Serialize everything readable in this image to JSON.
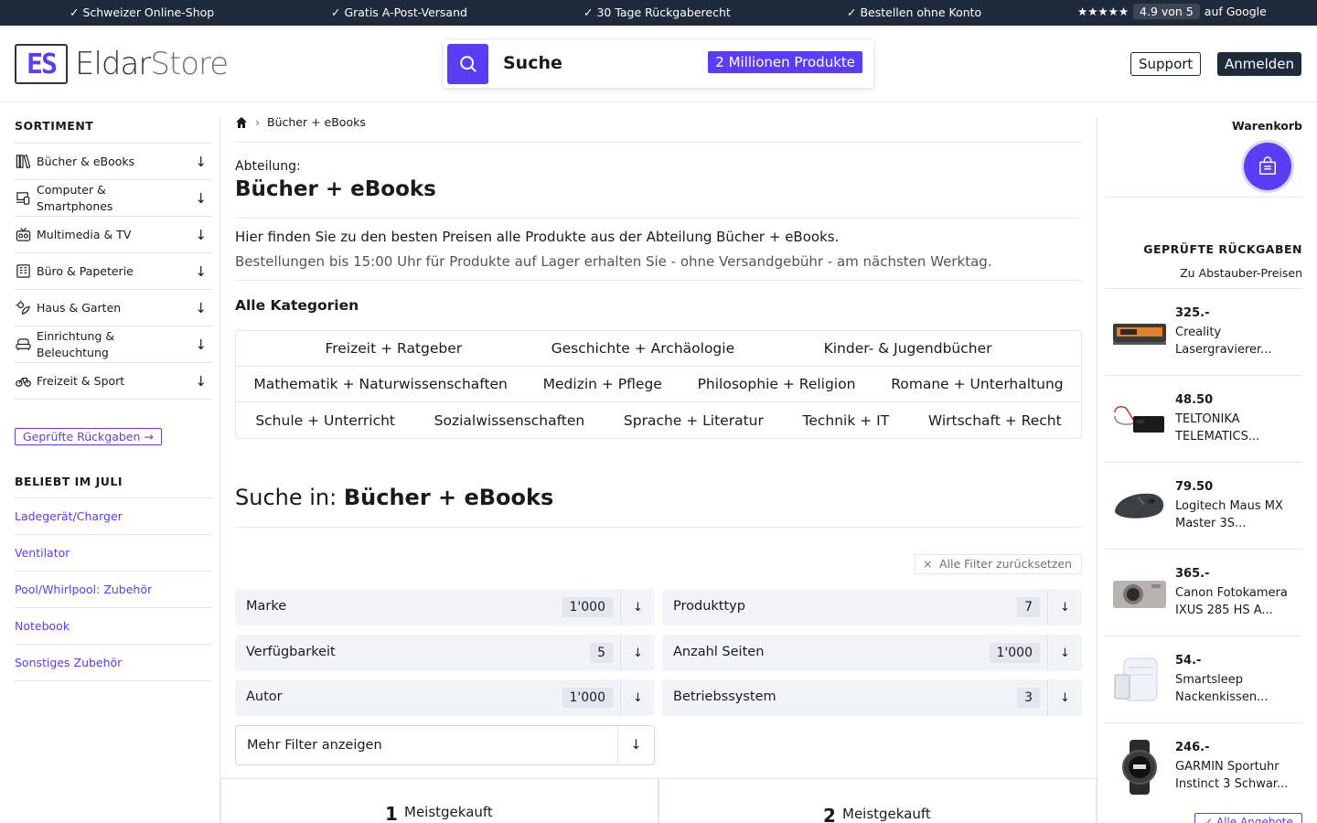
{
  "topbar": {
    "items": [
      "✓ Schweizer Online-Shop",
      "✓ Gratis A-Post-Versand",
      "✓ 30 Tage Rückgaberecht",
      "✓ Bestellen ohne Konto"
    ],
    "rating_stars": "★★★★★",
    "rating_score": "4.9 von 5",
    "rating_suffix": "auf Google"
  },
  "header": {
    "logo_mark": "ES",
    "logo_name": "Eldar",
    "logo_store": "Store",
    "search_label": "Suche",
    "search_badge": "2 Millionen Produkte",
    "support": "Support",
    "login": "Anmelden"
  },
  "sidebar": {
    "heading": "SORTIMENT",
    "categories": [
      {
        "label": "Bücher & eBooks",
        "icon": "books-icon"
      },
      {
        "label": "Computer & Smartphones",
        "icon": "devices-icon"
      },
      {
        "label": "Multimedia & TV",
        "icon": "tv-icon"
      },
      {
        "label": "Büro & Papeterie",
        "icon": "office-icon"
      },
      {
        "label": "Haus & Garten",
        "icon": "garden-icon"
      },
      {
        "label": "Einrichtung & Beleuchtung",
        "icon": "armchair-icon"
      },
      {
        "label": "Freizeit & Sport",
        "icon": "bicycle-icon"
      }
    ],
    "arrow": "↓",
    "returns_button": "Geprüfte Rückgaben →",
    "popular_heading": "BELIEBT IM JULI",
    "popular": [
      "Ladegerät/Charger",
      "Ventilator",
      "Pool/Whirlpool: Zubehör",
      "Notebook",
      "Sonstiges Zubehör"
    ]
  },
  "main": {
    "breadcrumb": "Bücher + eBooks",
    "dept_label": "Abteilung:",
    "dept_title": "Bücher + eBooks",
    "intro1": "Hier finden Sie zu den besten Preisen alle Produkte aus der Abteilung Bücher + eBooks.",
    "intro2": "Bestellungen bis 15:00 Uhr für Produkte auf Lager erhalten Sie - ohne Versandgebühr - am nächsten Werktag.",
    "all_categories": "Alle Kategorien",
    "category_rows": [
      [
        "Freizeit + Ratgeber",
        "Geschichte + Archäologie",
        "Kinder- & Jugendbücher"
      ],
      [
        "Mathematik + Naturwissenschaften",
        "Medizin + Pflege",
        "Philosophie + Religion",
        "Romane + Unterhaltung"
      ],
      [
        "Schule + Unterricht",
        "Sozialwissenschaften",
        "Sprache + Literatur",
        "Technik + IT",
        "Wirtschaft + Recht"
      ]
    ],
    "search_in_prefix": "Suche in:",
    "search_in_value": "Bücher + eBooks",
    "reset_filters": "Alle Filter zurücksetzen",
    "filters": [
      {
        "label": "Marke",
        "count": "1'000"
      },
      {
        "label": "Produkttyp",
        "count": "7"
      },
      {
        "label": "Verfügbarkeit",
        "count": "5"
      },
      {
        "label": "Anzahl Seiten",
        "count": "1'000"
      },
      {
        "label": "Autor",
        "count": "1'000"
      },
      {
        "label": "Betriebssystem",
        "count": "3"
      }
    ],
    "filter_arrow": "↓",
    "more_filters": "Mehr Filter anzeigen",
    "best": [
      {
        "num": "1",
        "label": "Meistgekauft"
      },
      {
        "num": "2",
        "label": "Meistgekauft"
      }
    ]
  },
  "right": {
    "cart_heading": "Warenkorb",
    "returns_heading": "GEPRÜFTE RÜCKGABEN",
    "returns_sub": "Zu Abstauber-Preisen",
    "offers": [
      {
        "price": "325.-",
        "name": "Creality Lasergravierer..."
      },
      {
        "price": "48.50",
        "name": "TELTONIKA TELEMATICS..."
      },
      {
        "price": "79.50",
        "name": "Logitech Maus MX Master 3S..."
      },
      {
        "price": "365.-",
        "name": "Canon Fotokamera IXUS 285 HS A..."
      },
      {
        "price": "54.-",
        "name": "Smartsleep Nackenkissen..."
      },
      {
        "price": "246.-",
        "name": "GARMIN Sportuhr Instinct 3 Schwar..."
      }
    ],
    "all_offers": "✓ Alle Angebote"
  },
  "colors": {
    "accent": "#5b3df5",
    "dark": "#1f2a3c",
    "border": "#e5e7eb"
  }
}
